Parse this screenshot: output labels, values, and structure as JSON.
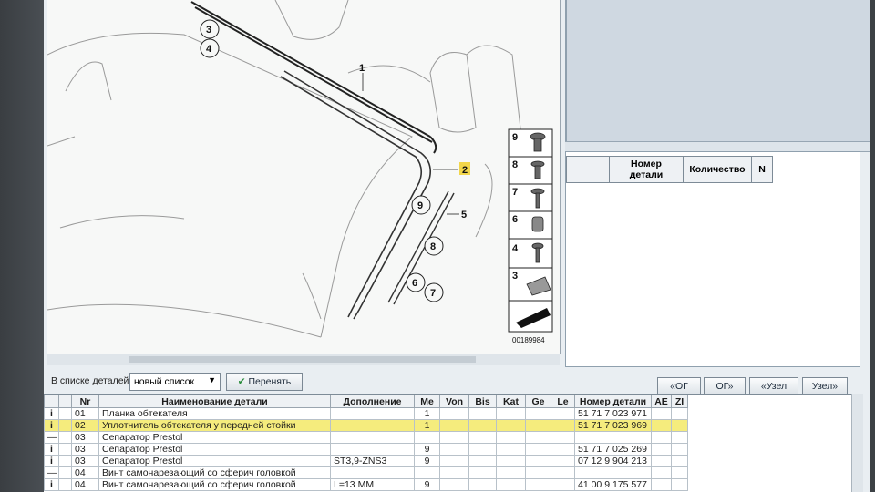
{
  "diagram": {
    "callouts": [
      "1",
      "2",
      "3",
      "4",
      "5",
      "6",
      "7",
      "8",
      "9"
    ],
    "legend": [
      {
        "no": "9"
      },
      {
        "no": "8"
      },
      {
        "no": "7"
      },
      {
        "no": "6"
      },
      {
        "no": "4"
      },
      {
        "no": "3"
      }
    ],
    "image_code": "00189984"
  },
  "right_table": {
    "headers": [
      "",
      "Номер детали",
      "Количество",
      "N"
    ]
  },
  "toolbar": {
    "in_list_label": "В списке деталей",
    "list_value": "новый список",
    "transfer_label": "Перенять",
    "og_prev": "«ОГ",
    "og_next": "ОГ»",
    "node_prev": "«Узел",
    "node_next": "Узел»"
  },
  "grid": {
    "headers": [
      "",
      "",
      "Nr",
      "Наименование детали",
      "Дополнение",
      "Me",
      "Von",
      "Bis",
      "Kat",
      "Ge",
      "Le",
      "Номер детали",
      "AE",
      "ZI"
    ],
    "rows": [
      {
        "icon": "i",
        "nr": "01",
        "name": "Планка обтекателя",
        "add": "",
        "me": "1",
        "part": "51 71 7 023 971",
        "highlight": false
      },
      {
        "icon": "i",
        "nr": "02",
        "name": "Уплотнитель обтекателя у передней стойки",
        "add": "",
        "me": "1",
        "part": "51 71 7 023 969",
        "highlight": true
      },
      {
        "icon": "—",
        "nr": "03",
        "name": "Сепаратор Prestol",
        "add": "",
        "me": "",
        "part": "",
        "highlight": false
      },
      {
        "icon": "i",
        "nr": "03",
        "name": "Сепаратор Prestol",
        "add": "",
        "me": "9",
        "part": "51 71 7 025 269",
        "highlight": false
      },
      {
        "icon": "i",
        "nr": "03",
        "name": "Сепаратор Prestol",
        "add": "ST3,9-ZNS3",
        "me": "9",
        "part": "07 12 9 904 213",
        "highlight": false
      },
      {
        "icon": "—",
        "nr": "04",
        "name": "Винт самонарезающий со сферич головкой",
        "add": "",
        "me": "",
        "part": "",
        "highlight": false
      },
      {
        "icon": "i",
        "nr": "04",
        "name": "Винт самонарезающий со сферич головкой",
        "add": "L=13 MM",
        "me": "9",
        "part": "41 00 9 175 577",
        "highlight": false
      }
    ]
  }
}
